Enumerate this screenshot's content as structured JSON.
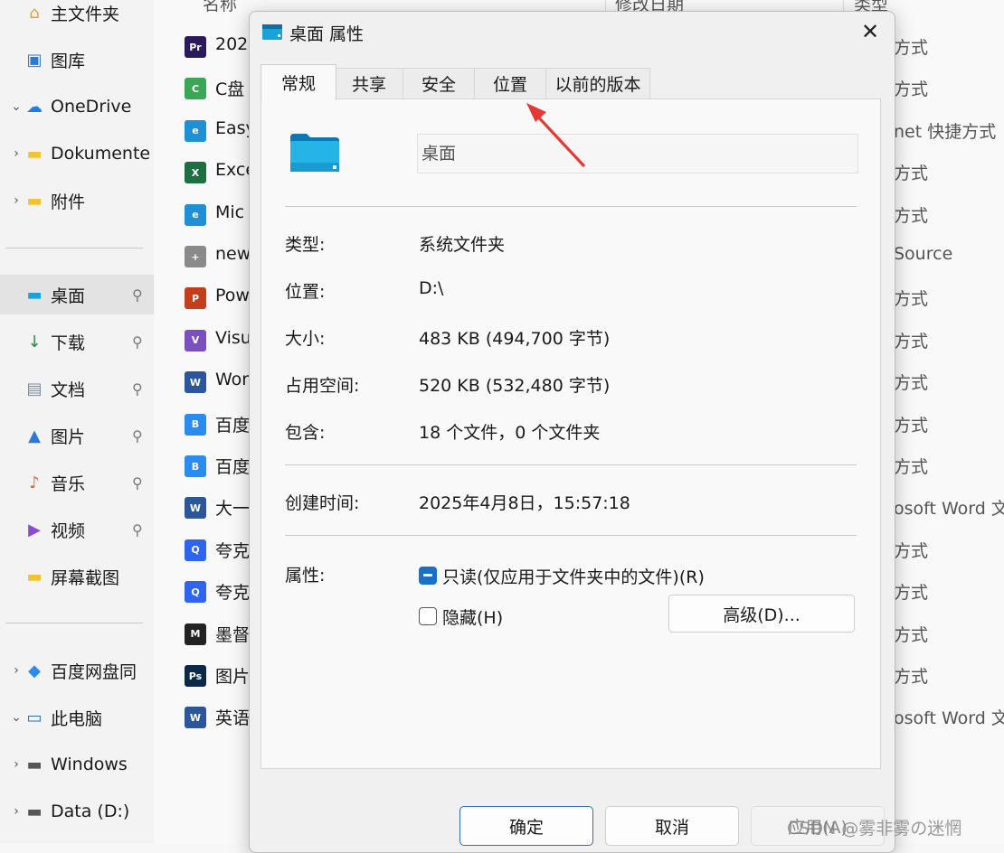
{
  "nav": {
    "items": [
      {
        "label": "主文件夹",
        "icon": "home-icon",
        "chevron": "",
        "pinned": false,
        "selected": false
      },
      {
        "label": "图库",
        "icon": "gallery-icon",
        "chevron": "",
        "pinned": false,
        "selected": false
      },
      {
        "label": "OneDrive",
        "icon": "cloud-icon",
        "chevron": "v",
        "pinned": false,
        "selected": false
      },
      {
        "label": "Dokumente",
        "icon": "folder-icon",
        "chevron": ">",
        "pinned": false,
        "selected": false
      },
      {
        "label": "附件",
        "icon": "folder-icon",
        "chevron": ">",
        "pinned": false,
        "selected": false
      },
      {
        "label": "桌面",
        "icon": "desktop-icon",
        "chevron": "",
        "pinned": true,
        "selected": true
      },
      {
        "label": "下载",
        "icon": "download-icon",
        "chevron": "",
        "pinned": true,
        "selected": false
      },
      {
        "label": "文档",
        "icon": "document-icon",
        "chevron": "",
        "pinned": true,
        "selected": false
      },
      {
        "label": "图片",
        "icon": "pictures-icon",
        "chevron": "",
        "pinned": true,
        "selected": false
      },
      {
        "label": "音乐",
        "icon": "music-icon",
        "chevron": "",
        "pinned": true,
        "selected": false
      },
      {
        "label": "视频",
        "icon": "video-icon",
        "chevron": "",
        "pinned": true,
        "selected": false
      },
      {
        "label": "屏幕截图",
        "icon": "folder-icon",
        "chevron": "",
        "pinned": false,
        "selected": false
      },
      {
        "label": "百度网盘同",
        "icon": "baidu-netdisk-icon",
        "chevron": ">",
        "pinned": false,
        "selected": false
      },
      {
        "label": "此电脑",
        "icon": "computer-icon",
        "chevron": "v",
        "pinned": false,
        "selected": false
      },
      {
        "label": "Windows",
        "icon": "drive-icon",
        "chevron": ">",
        "pinned": false,
        "selected": false
      },
      {
        "label": "Data (D:)",
        "icon": "drive-icon",
        "chevron": ">",
        "pinned": false,
        "selected": false
      }
    ]
  },
  "filelist": {
    "columns": [
      "名称",
      "修改日期",
      "类型"
    ],
    "rows": [
      {
        "name": "202",
        "type": "方式",
        "icon": "premiere-icon",
        "color": "#2b1a5a",
        "glyph": "Pr"
      },
      {
        "name": "C盘",
        "type": "方式",
        "icon": "app-shortcut-icon",
        "color": "#3aa757",
        "glyph": "C"
      },
      {
        "name": "Easy",
        "type": "net 快捷方式",
        "icon": "edge-icon",
        "color": "#1f8fd6",
        "glyph": "e"
      },
      {
        "name": "Exce",
        "type": "方式",
        "icon": "excel-icon",
        "color": "#1d6f42",
        "glyph": "X"
      },
      {
        "name": "Mic",
        "type": "方式",
        "icon": "edge-icon",
        "color": "#1f8fd6",
        "glyph": "e"
      },
      {
        "name": "new",
        "type": "Source",
        "icon": "new-file-icon",
        "color": "#8a8a8a",
        "glyph": "+"
      },
      {
        "name": "Pow",
        "type": "方式",
        "icon": "powerpoint-icon",
        "color": "#c43e1c",
        "glyph": "P"
      },
      {
        "name": "Visu",
        "type": "方式",
        "icon": "visual-studio-icon",
        "color": "#7a4fbf",
        "glyph": "V"
      },
      {
        "name": "Wor",
        "type": "方式",
        "icon": "word-icon",
        "color": "#2b579a",
        "glyph": "W"
      },
      {
        "name": "百度",
        "type": "方式",
        "icon": "baidu-netdisk-icon",
        "color": "#2a8cf0",
        "glyph": "B"
      },
      {
        "name": "百度",
        "type": "方式",
        "icon": "baidu-netdisk-icon",
        "color": "#2a8cf0",
        "glyph": "B"
      },
      {
        "name": "大一",
        "type": "osoft Word 文",
        "icon": "word-icon",
        "color": "#2b579a",
        "glyph": "W"
      },
      {
        "name": "夸克",
        "type": "方式",
        "icon": "quark-icon",
        "color": "#2f64f0",
        "glyph": "Q"
      },
      {
        "name": "夸克",
        "type": "方式",
        "icon": "quark-icon",
        "color": "#2f64f0",
        "glyph": "Q"
      },
      {
        "name": "墨督",
        "type": "方式",
        "icon": "app-shortcut-icon",
        "color": "#222222",
        "glyph": "M"
      },
      {
        "name": "图片",
        "type": "方式",
        "icon": "photoshop-icon",
        "color": "#0b2a4a",
        "glyph": "Ps"
      },
      {
        "name": "英语",
        "type": "osoft Word 文",
        "icon": "word-icon",
        "color": "#2b579a",
        "glyph": "W"
      }
    ]
  },
  "dialog": {
    "title": "桌面 属性",
    "tabs": [
      {
        "label": "常规",
        "active": true
      },
      {
        "label": "共享",
        "active": false
      },
      {
        "label": "安全",
        "active": false
      },
      {
        "label": "位置",
        "active": false
      },
      {
        "label": "以前的版本",
        "active": false
      }
    ],
    "folder_name": "桌面",
    "props": {
      "type_label": "类型:",
      "type_value": "系统文件夹",
      "location_label": "位置:",
      "location_value": "D:\\",
      "size_label": "大小:",
      "size_value": "483 KB (494,700 字节)",
      "disk_label": "占用空间:",
      "disk_value": "520 KB (532,480 字节)",
      "contains_label": "包含:",
      "contains_value": "18 个文件，0 个文件夹",
      "created_label": "创建时间:",
      "created_value": "2025年4月8日，15:57:18",
      "attributes_label": "属性:"
    },
    "readonly_label": "只读(仅应用于文件夹中的文件)(R)",
    "hidden_label": "隐藏(H)",
    "advanced_label": "高级(D)...",
    "ok_label": "确定",
    "cancel_label": "取消",
    "apply_label": "应用(A)"
  },
  "watermark": "CSDN @雾非雾の迷惘",
  "colors": {
    "accent": "#1a6fc9",
    "arrow": "#e53935"
  }
}
